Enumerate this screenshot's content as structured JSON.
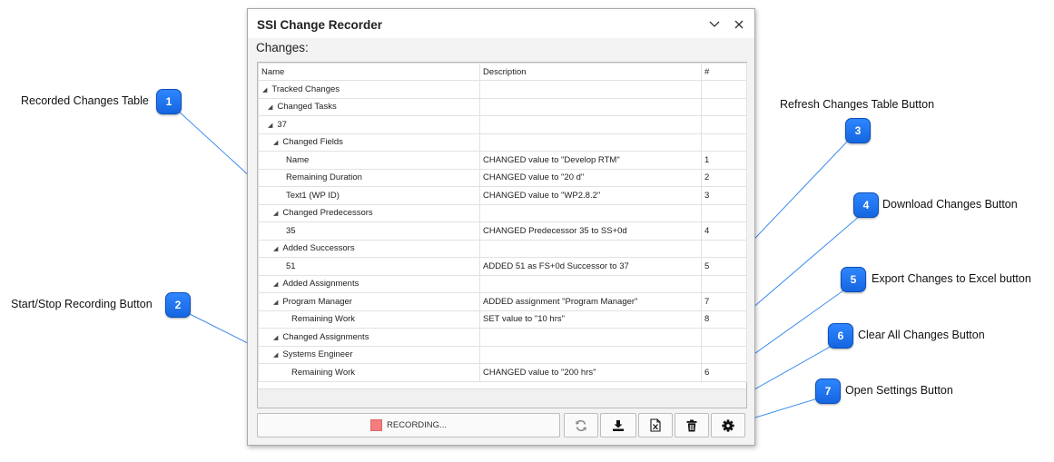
{
  "window": {
    "title": "SSI Change Recorder",
    "section_label": "Changes:"
  },
  "table": {
    "columns": [
      "Name",
      "Description",
      "#"
    ],
    "rows": [
      {
        "name": "Tracked Changes",
        "desc": "",
        "num": "",
        "indent": 0,
        "expander": true
      },
      {
        "name": "Changed Tasks",
        "desc": "",
        "num": "",
        "indent": 1,
        "expander": true
      },
      {
        "name": "37",
        "desc": "",
        "num": "",
        "indent": 1,
        "expander": true
      },
      {
        "name": "Changed Fields",
        "desc": "",
        "num": "",
        "indent": 2,
        "expander": true
      },
      {
        "name": "Name",
        "desc": "CHANGED value to \"Develop RTM\"",
        "num": "1",
        "indent": 3,
        "expander": false
      },
      {
        "name": "Remaining Duration",
        "desc": "CHANGED value to \"20 d\"",
        "num": "2",
        "indent": 3,
        "expander": false
      },
      {
        "name": "Text1 (WP ID)",
        "desc": "CHANGED value to \"WP2.8.2\"",
        "num": "3",
        "indent": 3,
        "expander": false
      },
      {
        "name": "Changed Predecessors",
        "desc": "",
        "num": "",
        "indent": 2,
        "expander": true
      },
      {
        "name": "35",
        "desc": "CHANGED Predecessor 35 to SS+0d",
        "num": "4",
        "indent": 3,
        "expander": false
      },
      {
        "name": "Added Successors",
        "desc": "",
        "num": "",
        "indent": 2,
        "expander": true
      },
      {
        "name": "51",
        "desc": "ADDED 51 as FS+0d Successor to 37",
        "num": "5",
        "indent": 3,
        "expander": false
      },
      {
        "name": "Added Assignments",
        "desc": "",
        "num": "",
        "indent": 2,
        "expander": true
      },
      {
        "name": "Program Manager",
        "desc": "ADDED assignment \"Program Manager\"",
        "num": "7",
        "indent": 2,
        "expander": true
      },
      {
        "name": "Remaining Work",
        "desc": "SET value to \"10 hrs\"",
        "num": "8",
        "indent": 4,
        "expander": false
      },
      {
        "name": "Changed Assignments",
        "desc": "",
        "num": "",
        "indent": 2,
        "expander": true
      },
      {
        "name": "Systems Engineer",
        "desc": "",
        "num": "",
        "indent": 2,
        "expander": true
      },
      {
        "name": "Remaining Work",
        "desc": "CHANGED value to \"200 hrs\"",
        "num": "6",
        "indent": 4,
        "expander": false
      }
    ]
  },
  "toolbar": {
    "record_label": "RECORDING..."
  },
  "callouts": [
    {
      "num": "1",
      "label": "Recorded Changes Table"
    },
    {
      "num": "2",
      "label": "Start/Stop Recording Button"
    },
    {
      "num": "3",
      "label": "Refresh Changes Table Button"
    },
    {
      "num": "4",
      "label": "Download Changes Button"
    },
    {
      "num": "5",
      "label": "Export Changes to Excel button"
    },
    {
      "num": "6",
      "label": "Clear All Changes Button"
    },
    {
      "num": "7",
      "label": "Open Settings Button"
    }
  ],
  "colors": {
    "badge": "#1f76f0",
    "recording_indicator": "#f47c7c",
    "leader_line": "#3c8cf0"
  },
  "icons": [
    "minimize-chevron-icon",
    "close-icon",
    "refresh-icon",
    "download-icon",
    "excel-export-icon",
    "trash-icon",
    "gear-icon",
    "expand-triangle-icon"
  ]
}
